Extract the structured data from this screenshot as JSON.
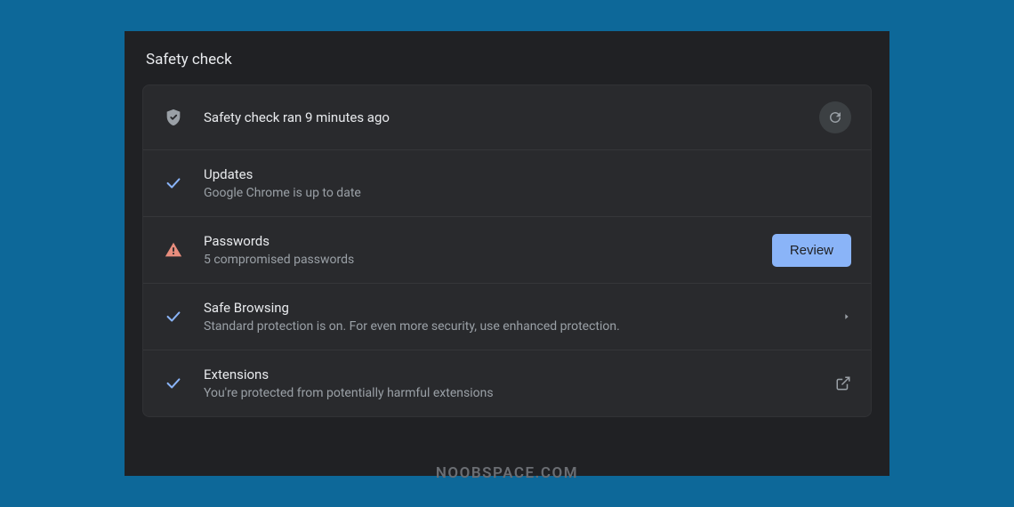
{
  "panel": {
    "title": "Safety check"
  },
  "header": {
    "status": "Safety check ran 9 minutes ago"
  },
  "rows": {
    "updates": {
      "title": "Updates",
      "subtitle": "Google Chrome is up to date"
    },
    "passwords": {
      "title": "Passwords",
      "subtitle": "5 compromised passwords",
      "action": "Review"
    },
    "safebrowsing": {
      "title": "Safe Browsing",
      "subtitle": "Standard protection is on. For even more security, use enhanced protection."
    },
    "extensions": {
      "title": "Extensions",
      "subtitle": "You're protected from potentially harmful extensions"
    }
  },
  "watermark": "NOOBSPACE.COM"
}
